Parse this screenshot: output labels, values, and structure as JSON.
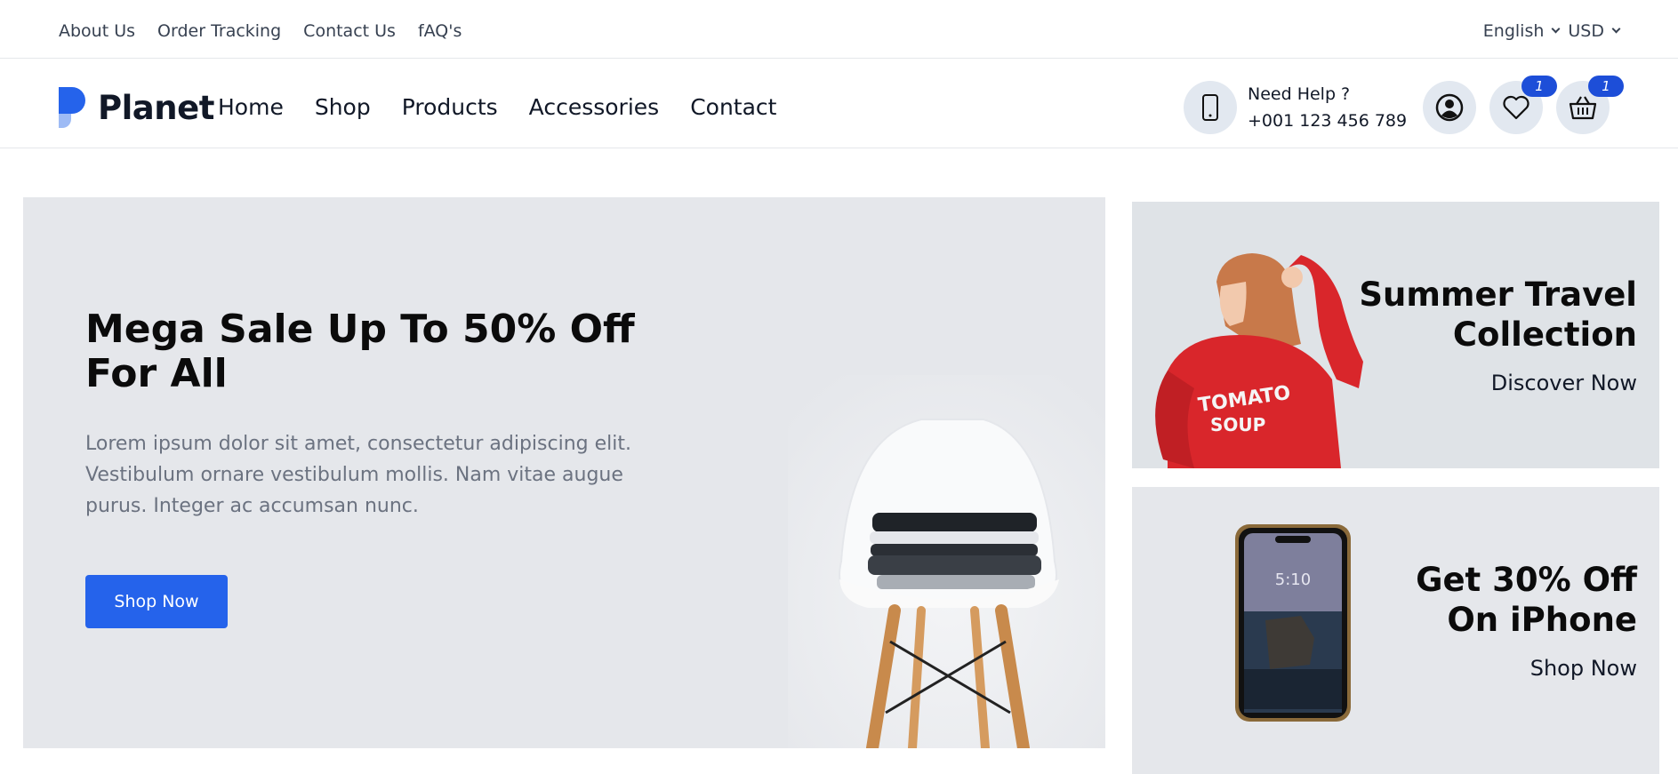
{
  "topbar": {
    "links": [
      "About Us",
      "Order Tracking",
      "Contact Us",
      "fAQ's"
    ],
    "language": "English",
    "currency": "USD"
  },
  "header": {
    "logo_text": "Planet",
    "nav": [
      "Home",
      "Shop",
      "Products",
      "Accessories",
      "Contact"
    ],
    "help_title": "Need Help ?",
    "help_phone": "+001 123 456 789",
    "wishlist_count": "1",
    "cart_count": "1"
  },
  "hero": {
    "title": "Mega Sale Up To 50% Off For All",
    "description": "Lorem ipsum dolor sit amet, consectetur adipiscing elit. Vestibulum ornare vestibulum mollis. Nam vitae augue purus. Integer ac accumsan nunc.",
    "button_label": "Shop Now"
  },
  "banners": [
    {
      "title": "Summer Travel Collection",
      "link": "Discover Now",
      "shirt_text_1": "TOMATO",
      "shirt_text_2": "SOUP"
    },
    {
      "title": "Get 30% Off On iPhone",
      "link": "Shop Now",
      "phone_time": "5:10"
    }
  ],
  "colors": {
    "accent": "#2563eb",
    "badge": "#1d4ed8",
    "hero_bg": "#e5e7eb"
  }
}
